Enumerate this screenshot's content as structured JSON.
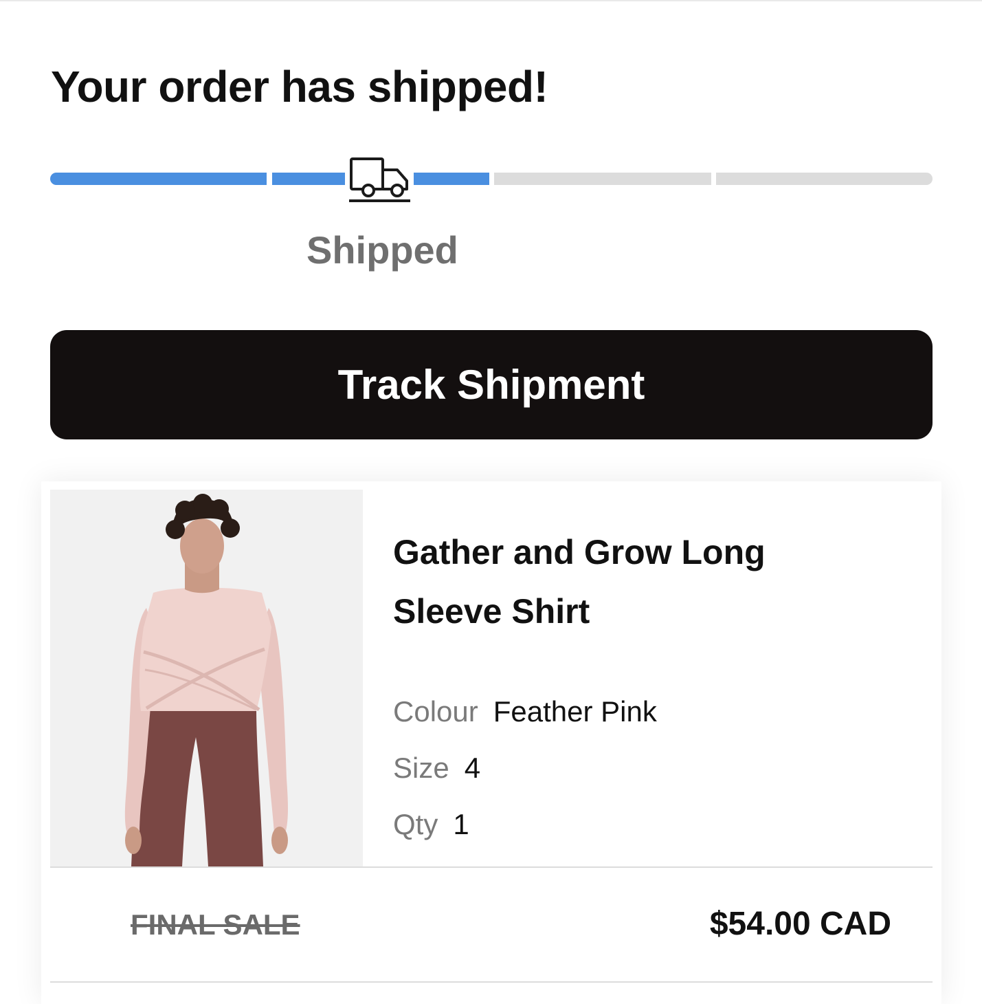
{
  "header": {
    "title": "Your order has shipped!"
  },
  "progress": {
    "steps_total": 4,
    "steps_completed": 1.5,
    "current_step_label": "Shipped",
    "current_step_icon": "truck-icon",
    "active_color": "#4a8fe0",
    "inactive_color": "#dcdcdc"
  },
  "actions": {
    "track_label": "Track Shipment"
  },
  "item": {
    "name": "Gather and Grow Long Sleeve Shirt",
    "colour_label": "Colour",
    "colour_value": "Feather Pink",
    "size_label": "Size",
    "size_value": "4",
    "qty_label": "Qty",
    "qty_value": "1",
    "sale_tag": "FINAL SALE",
    "price": "$54.00 CAD"
  }
}
